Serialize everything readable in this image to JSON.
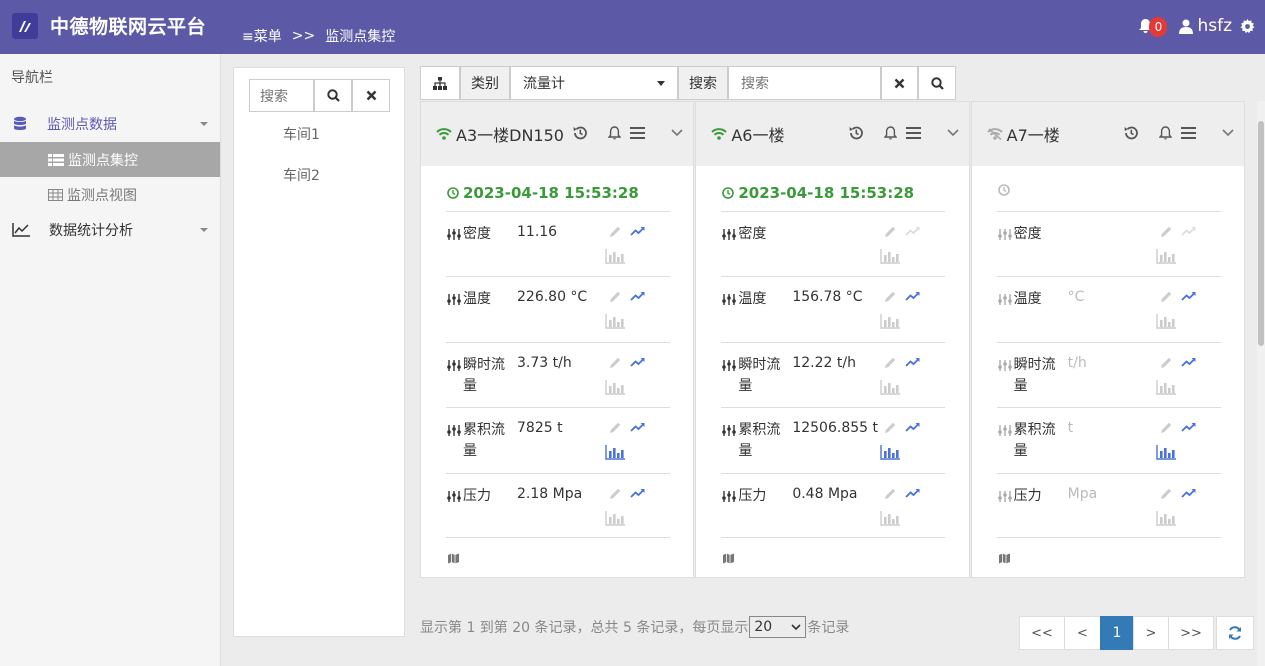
{
  "app": {
    "title": "中德物联网云平台",
    "breadcrumb": {
      "menu": "≡菜单",
      "sep": ">>",
      "current": "监测点集控"
    },
    "notifications": "0",
    "username": "hsfz",
    "colors": {
      "header": "#5c5aa6",
      "accent": "#5a5ab8",
      "ok_green": "#3a9a3a",
      "badge": "#e53935",
      "active_page": "#337ab7"
    }
  },
  "nav": {
    "header": "导航栏",
    "groups": [
      {
        "label": "监测点数据",
        "icon": "database-icon",
        "items": [
          {
            "label": "监测点集控",
            "icon": "list-icon"
          },
          {
            "label": "监测点视图",
            "icon": "table-icon"
          }
        ]
      },
      {
        "label": "数据统计分析",
        "icon": "line-chart-icon"
      }
    ]
  },
  "tree": {
    "search_placeholder": "搜索",
    "nodes": [
      "车间1",
      "车间2"
    ]
  },
  "filter": {
    "category_label": "类别",
    "category_value": "流量计",
    "search_label": "搜索",
    "search_placeholder": "搜索"
  },
  "cards": [
    {
      "name": "A3一楼DN150",
      "online": true,
      "time": "2023-04-18 15:53:28",
      "rows": [
        {
          "name": "密度",
          "value": "11.16"
        },
        {
          "name": "温度",
          "value": "226.80 °C"
        },
        {
          "name": "瞬时流量",
          "value": "3.73 t/h"
        },
        {
          "name": "累积流量",
          "value": "7825 t"
        },
        {
          "name": "压力",
          "value": "2.18 Mpa"
        }
      ]
    },
    {
      "name": "A6一楼",
      "online": true,
      "time": "2023-04-18 15:53:28",
      "rows": [
        {
          "name": "密度",
          "value": ""
        },
        {
          "name": "温度",
          "value": "156.78 °C"
        },
        {
          "name": "瞬时流量",
          "value": "12.22 t/h"
        },
        {
          "name": "累积流量",
          "value": "12506.855 t"
        },
        {
          "name": "压力",
          "value": "0.48 Mpa"
        }
      ]
    },
    {
      "name": "A7一楼",
      "online": false,
      "time": "",
      "rows": [
        {
          "name": "密度",
          "value": ""
        },
        {
          "name": "温度",
          "value": "°C"
        },
        {
          "name": "瞬时流量",
          "value": "t/h"
        },
        {
          "name": "累积流量",
          "value": "t"
        },
        {
          "name": "压力",
          "value": "Mpa"
        }
      ]
    }
  ],
  "footer": {
    "info_prefix": "显示第 1 到第 20 条记录，总共 5 条记录，每页显示",
    "page_size": "20",
    "info_suffix": "条记录",
    "pager": [
      "<<",
      "<",
      "1",
      ">",
      ">>"
    ]
  }
}
